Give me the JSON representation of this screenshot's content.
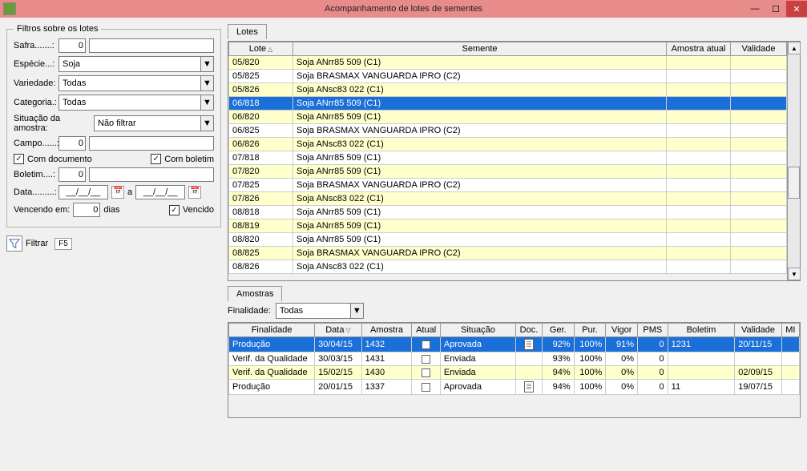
{
  "window": {
    "title": "Acompanhamento de lotes de sementes",
    "minimize": "—",
    "maximize": "☐",
    "close": "✕"
  },
  "filters": {
    "legend": "Filtros sobre os lotes",
    "safra_label": "Safra.......:",
    "safra_value": "0",
    "especie_label": "Espécie...:",
    "especie_value": "Soja",
    "variedade_label": "Variedade:",
    "variedade_value": "Todas",
    "categoria_label": "Categoria.:",
    "categoria_value": "Todas",
    "situacao_label": "Situação da amostra:",
    "situacao_value": "Não filtrar",
    "campo_label": "Campo......:",
    "campo_value": "0",
    "com_documento": "Com documento",
    "com_boletim": "Com boletim",
    "boletim_label": "Boletim....:",
    "boletim_value": "0",
    "data_label": "Data.........:",
    "date_placeholder": "__/__/__",
    "date_sep": "a",
    "vencendo_label": "Vencendo em:",
    "vencendo_value": "0",
    "dias_label": "dias",
    "vencido_label": "Vencido",
    "filtrar_label": "Filtrar",
    "f5_label": "F5"
  },
  "lotes": {
    "tab": "Lotes",
    "headers": {
      "lote": "Lote",
      "semente": "Semente",
      "amostra_atual": "Amostra atual",
      "validade": "Validade"
    },
    "rows": [
      {
        "lote": "05/820",
        "semente": "Soja ANrr85 509 (C1)",
        "alt": true
      },
      {
        "lote": "05/825",
        "semente": "Soja BRASMAX VANGUARDA IPRO (C2)",
        "alt": false
      },
      {
        "lote": "05/826",
        "semente": "Soja ANsc83 022 (C1)",
        "alt": true
      },
      {
        "lote": "06/818",
        "semente": "Soja ANrr85 509 (C1)",
        "sel": true
      },
      {
        "lote": "06/820",
        "semente": "Soja ANrr85 509 (C1)",
        "alt": true
      },
      {
        "lote": "06/825",
        "semente": "Soja BRASMAX VANGUARDA IPRO (C2)",
        "alt": false
      },
      {
        "lote": "06/826",
        "semente": "Soja ANsc83 022 (C1)",
        "alt": true
      },
      {
        "lote": "07/818",
        "semente": "Soja ANrr85 509 (C1)",
        "alt": false
      },
      {
        "lote": "07/820",
        "semente": "Soja ANrr85 509 (C1)",
        "alt": true
      },
      {
        "lote": "07/825",
        "semente": "Soja BRASMAX VANGUARDA IPRO (C2)",
        "alt": false
      },
      {
        "lote": "07/826",
        "semente": "Soja ANsc83 022 (C1)",
        "alt": true
      },
      {
        "lote": "08/818",
        "semente": "Soja ANrr85 509 (C1)",
        "alt": false
      },
      {
        "lote": "08/819",
        "semente": "Soja ANrr85 509 (C1)",
        "alt": true
      },
      {
        "lote": "08/820",
        "semente": "Soja ANrr85 509 (C1)",
        "alt": false
      },
      {
        "lote": "08/825",
        "semente": "Soja BRASMAX VANGUARDA IPRO (C2)",
        "alt": true
      },
      {
        "lote": "08/826",
        "semente": "Soja ANsc83 022 (C1)",
        "alt": false
      }
    ],
    "up": "▲",
    "down": "▼"
  },
  "amostras": {
    "tab": "Amostras",
    "finalidade_label": "Finalidade:",
    "finalidade_value": "Todas",
    "headers": {
      "finalidade": "Finalidade",
      "data": "Data",
      "amostra": "Amostra",
      "atual": "Atual",
      "situacao": "Situação",
      "doc": "Doc.",
      "ger": "Ger.",
      "pur": "Pur.",
      "vigor": "Vigor",
      "pms": "PMS",
      "boletim": "Boletim",
      "validade": "Validade",
      "mi": "MI"
    },
    "rows": [
      {
        "finalidade": "Produção",
        "data": "30/04/15",
        "amostra": "1432",
        "atual": true,
        "situacao": "Aprovada",
        "doc": true,
        "ger": "92%",
        "pur": "100%",
        "vigor": "91%",
        "pms": "0",
        "boletim": "1231",
        "validade": "20/11/15",
        "sel": true
      },
      {
        "finalidade": "Verif. da Qualidade",
        "data": "30/03/15",
        "amostra": "1431",
        "atual": false,
        "situacao": "Enviada",
        "doc": false,
        "ger": "93%",
        "pur": "100%",
        "vigor": "0%",
        "pms": "0",
        "boletim": "",
        "validade": "",
        "alt": false
      },
      {
        "finalidade": "Verif. da Qualidade",
        "data": "15/02/15",
        "amostra": "1430",
        "atual": false,
        "situacao": "Enviada",
        "doc": false,
        "ger": "94%",
        "pur": "100%",
        "vigor": "0%",
        "pms": "0",
        "boletim": "",
        "validade": "02/09/15",
        "alt": true
      },
      {
        "finalidade": "Produção",
        "data": "20/01/15",
        "amostra": "1337",
        "atual": false,
        "situacao": "Aprovada",
        "doc": true,
        "ger": "94%",
        "pur": "100%",
        "vigor": "0%",
        "pms": "0",
        "boletim": "11",
        "validade": "19/07/15",
        "alt": false
      }
    ]
  }
}
